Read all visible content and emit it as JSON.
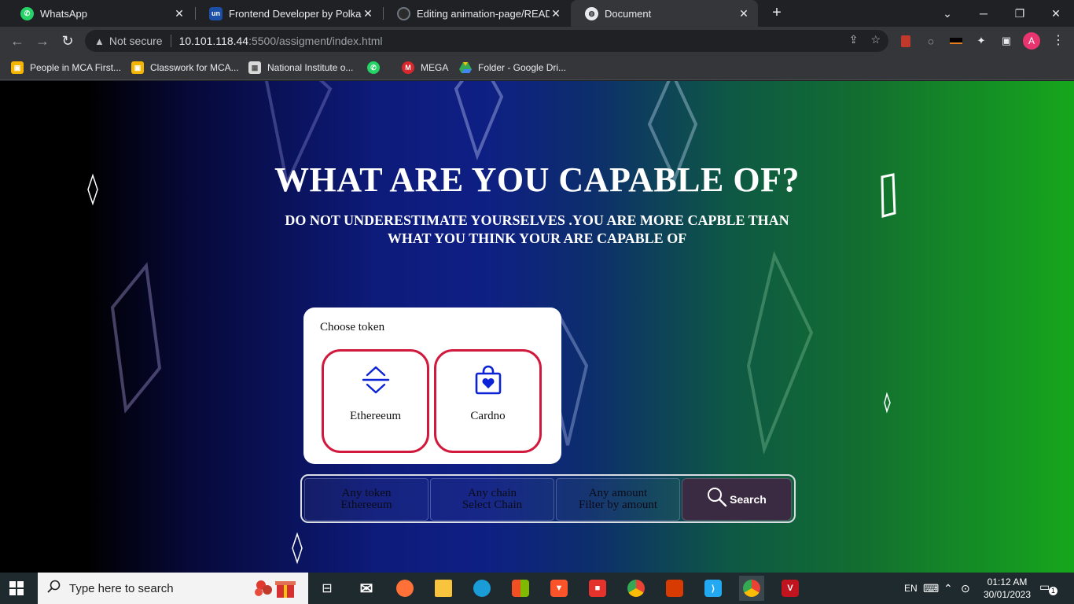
{
  "browser": {
    "tabs": [
      {
        "title": "WhatsApp",
        "active": false,
        "favicon": "whatsapp-icon"
      },
      {
        "title": "Frontend Developer by Polkadex",
        "active": false,
        "favicon": "unstop-icon"
      },
      {
        "title": "Editing animation-page/README",
        "active": false,
        "favicon": "github-icon"
      },
      {
        "title": "Document",
        "active": true,
        "favicon": "globe-icon"
      }
    ],
    "address": {
      "security_label": "Not secure",
      "host": "10.101.118.44",
      "path": ":5500/assigment/index.html"
    },
    "profile_initial": "A",
    "bookmarks": [
      {
        "label": "People in MCA First...",
        "icon": "classroom-icon"
      },
      {
        "label": "Classwork for MCA...",
        "icon": "classroom-icon"
      },
      {
        "label": "National Institute o...",
        "icon": "nit-icon"
      },
      {
        "label": "",
        "icon": "whatsapp-icon"
      },
      {
        "label": "MEGA",
        "icon": "mega-icon"
      },
      {
        "label": "Folder - Google Dri...",
        "icon": "google-drive-icon"
      }
    ]
  },
  "page": {
    "title": "WHAT ARE YOU CAPABLE OF?",
    "subtitle": "DO NOT UNDERESTIMATE YOURSELVES .YOU ARE MORE CAPBLE THAN WHAT YOU THINK YOUR ARE CAPABLE OF",
    "token_card": {
      "label": "Choose token",
      "tokens": [
        {
          "name": "Ethereeum",
          "icon": "swap-vertical-icon"
        },
        {
          "name": "Cardno",
          "icon": "shopping-bag-heart-icon"
        }
      ]
    },
    "search_bar": {
      "token": {
        "label": "Any token",
        "value": "Ethereeum"
      },
      "chain": {
        "label": "Any chain",
        "value": "Select Chain"
      },
      "amount": {
        "label": "Any amount",
        "value": "Filter by amount"
      },
      "button_label": "Search"
    },
    "colors": {
      "accent": "#d1193e",
      "icon_blue": "#0b22d6",
      "gradient_left": "#000000",
      "gradient_mid": "#0e1f84",
      "gradient_right": "#16a61c"
    }
  },
  "taskbar": {
    "search_placeholder": "Type here to search",
    "language": "EN",
    "time": "01:12 AM",
    "date": "30/01/2023",
    "notification_count": "1"
  }
}
